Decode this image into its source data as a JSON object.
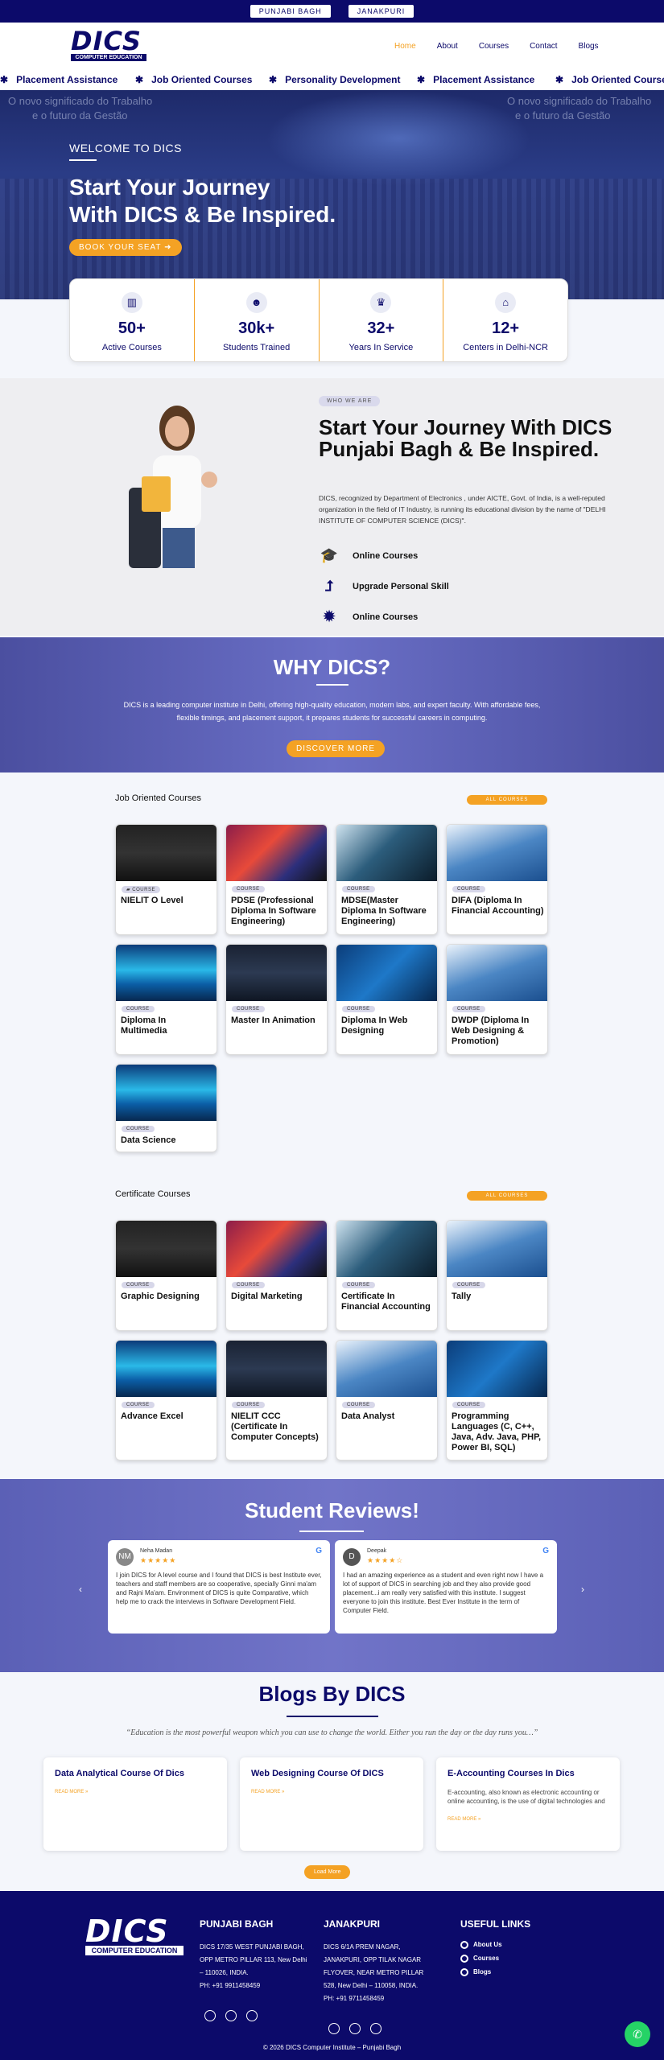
{
  "topbar": {
    "branch1": "PUNJABI BAGH",
    "branch2": "JANAKPURI"
  },
  "brand": {
    "logo_text": "DICS",
    "logo_sub": "COMPUTER EDUCATION"
  },
  "nav": {
    "items": [
      "Home",
      "About",
      "Courses",
      "Contact",
      "Blogs"
    ]
  },
  "ticker": [
    "Placement Assistance",
    "Job Oriented Courses",
    "Personality Development",
    "Placement Assistance",
    "Job Oriented Courses"
  ],
  "hero": {
    "bg_text1": "O novo significado do Trabalho",
    "bg_text2": "e o futuro da Gestão",
    "bg_text3": "O novo significado do Trabalho",
    "bg_text4": "e o futuro da Gestão",
    "welcome": "WELCOME TO DICS",
    "title_line1": "Start Your Journey",
    "title_line2": "With DICS & Be Inspired.",
    "cta": "BOOK YOUR SEAT"
  },
  "stats": [
    {
      "icon": "book-icon",
      "value": "50+",
      "label": "Active Courses"
    },
    {
      "icon": "students-icon",
      "value": "30k+",
      "label": "Students Trained"
    },
    {
      "icon": "trophy-icon",
      "value": "32+",
      "label": "Years In Service"
    },
    {
      "icon": "building-icon",
      "value": "12+",
      "label": "Centers in Delhi-NCR"
    }
  ],
  "about": {
    "tag": "WHO WE ARE",
    "title": "Start Your Journey With DICS Punjabi Bagh & Be Inspired.",
    "text": "DICS, recognized by Department of Electronics , under AICTE, Govt. of India, is a well-reputed organization in the field of IT Industry, is running its educational division by the name of \"DELHI INSTITUTE OF COMPUTER SCIENCE (DICS)\".",
    "features": [
      "Online Courses",
      "Upgrade Personal Skill",
      "Online Courses"
    ]
  },
  "why": {
    "title": "WHY DICS?",
    "text": "DICS is a leading computer institute in Delhi, offering high-quality education, modern labs, and expert faculty. With affordable fees, flexible timings, and placement support, it prepares students for successful careers in computing.",
    "cta": "DISCOVER MORE"
  },
  "job_courses": {
    "heading": "Job Oriented Courses",
    "button": "ALL COURSES",
    "tag": "COURSE",
    "items": [
      "NIELIT O Level",
      "PDSE (Professional Diploma In Software Engineering)",
      "MDSE(Master Diploma In Software Engineering)",
      "DIFA (Diploma In Financial Accounting)",
      "Diploma In Multimedia",
      "Master In Animation",
      "Diploma In Web Designing",
      "DWDP (Diploma In Web Designing & Promotion)",
      "Data Science"
    ]
  },
  "cert_courses": {
    "heading": "Certificate Courses",
    "button": "ALL COURSES",
    "tag": "COURSE",
    "items": [
      "Graphic Designing",
      "Digital Marketing",
      "Certificate In Financial Accounting",
      "Tally",
      "Advance Excel",
      "NIELIT CCC (Certificate In Computer Concepts)",
      "Data Analyst",
      "Programming Languages (C, C++, Java, Adv. Java, PHP, Power BI, SQL)"
    ]
  },
  "reviews": {
    "title": "Student Reviews!",
    "items": [
      {
        "initials": "NM",
        "name": "Neha Madan",
        "stars": "★★★★★",
        "text": "I join DICS for A level course and I found that DICS is best Institute ever, teachers and staff members are so cooperative, specially Ginni ma'am and Rajni Ma'am. Environment of DICS is quite Comparative, which help me to crack the interviews in Software Development Field."
      },
      {
        "initials": "D",
        "name": "Deepak",
        "stars": "★★★★☆",
        "text": "I had an amazing experience as a student and even right now I have a lot of support of DICS in searching job and they also provide good placement...i am really very satisfied with this institute. I suggest everyone to join this institute. Best Ever Institute in the term of Computer Field."
      }
    ]
  },
  "blogs": {
    "title": "Blogs By DICS",
    "quote": "“Education is the most powerful weapon which you can use to change the world. Either you run the day or the day runs you…”",
    "items": [
      {
        "title": "Data Analytical Course Of Dics",
        "text": "",
        "more": "READ MORE »"
      },
      {
        "title": "Web Designing Course Of DICS",
        "text": "",
        "more": "READ MORE »"
      },
      {
        "title": "E-Accounting Courses In Dics",
        "text": "E-accounting, also known as electronic accounting or online accounting, is the use of digital technologies and",
        "more": "READ MORE »"
      }
    ],
    "load_more": "Load More"
  },
  "footer": {
    "col1": {
      "title": "PUNJABI BAGH",
      "address": "DICS 17/35 WEST PUNJABI BAGH, OPP METRO PILLAR 113, New Delhi – 110026, INDIA.",
      "phone": "PH: +91 9911458459"
    },
    "col2": {
      "title": "JANAKPURI",
      "address": "DICS 6/1A PREM NAGAR, JANAKPURI, OPP TILAK NAGAR FLYOVER, NEAR METRO PILLAR 528, New Delhi – 110058, INDIA.",
      "phone": "PH: +91 9711458459"
    },
    "links_title": "USEFUL LINKS",
    "links": [
      "About Us",
      "Courses",
      "Blogs"
    ],
    "copyright": "© 2026 DICS Computer Institute – Punjabi Bagh"
  }
}
